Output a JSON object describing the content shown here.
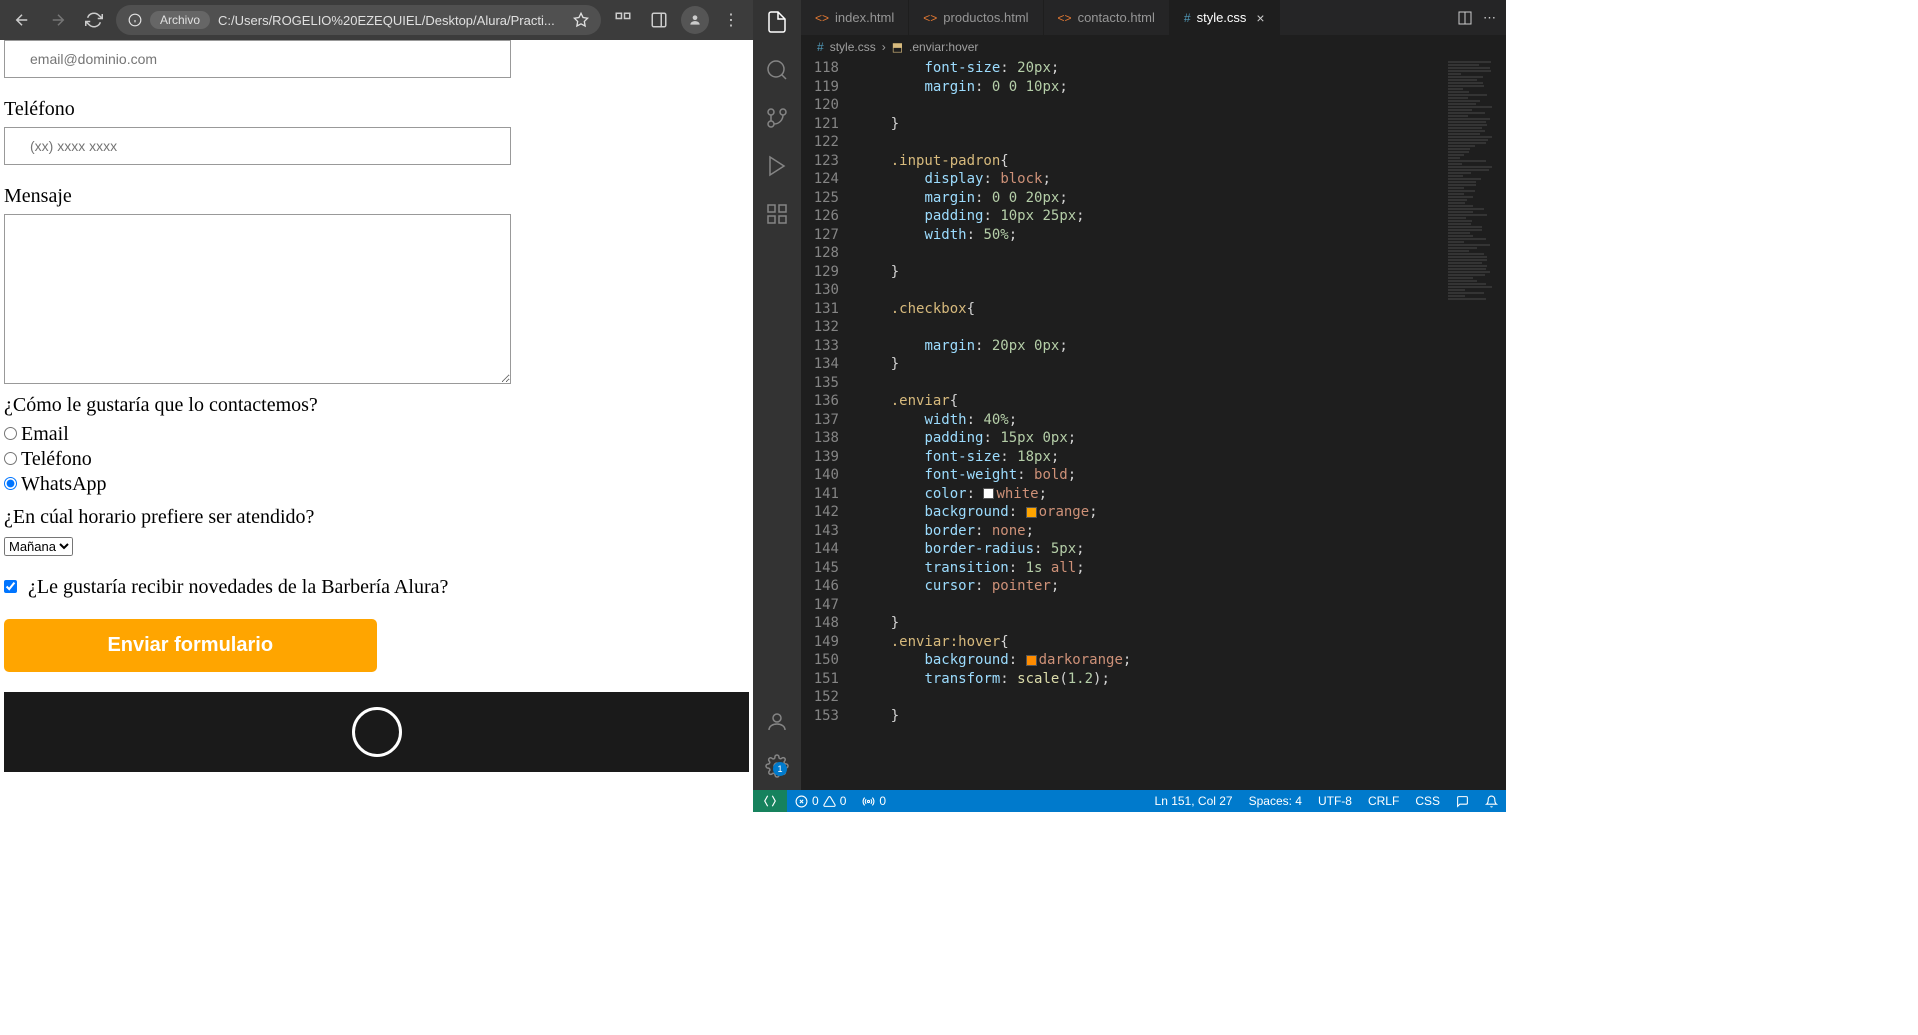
{
  "browser": {
    "url_chip": "Archivo",
    "url": "C:/Users/ROGELIO%20EZEQUIEL/Desktop/Alura/Practi...",
    "form": {
      "email_placeholder": "email@dominio.com",
      "telefono_label": "Teléfono",
      "telefono_placeholder": "(xx) xxxx xxxx",
      "mensaje_label": "Mensaje",
      "contact_question": "¿Cómo le gustaría que lo contactemos?",
      "radio_email": "Email",
      "radio_telefono": "Teléfono",
      "radio_whatsapp": "WhatsApp",
      "horario_question": "¿En cúal horario prefiere ser atendido?",
      "horario_option": "Mañana",
      "newsletter_label": "¿Le gustaría recibir novedades de la Barbería Alura?",
      "submit_label": "Enviar formulario"
    }
  },
  "vscode": {
    "tabs": [
      {
        "label": "index.html",
        "icon": "html"
      },
      {
        "label": "productos.html",
        "icon": "html"
      },
      {
        "label": "contacto.html",
        "icon": "html"
      },
      {
        "label": "style.css",
        "icon": "css",
        "active": true
      }
    ],
    "breadcrumbs": {
      "file": "style.css",
      "symbol": ".enviar:hover"
    },
    "lines": [
      {
        "n": 118,
        "t": "        <span class='tok-prop'>font-size</span><span class='tok-punct'>: </span><span class='tok-num'>20px</span><span class='tok-punct'>;</span>"
      },
      {
        "n": 119,
        "t": "        <span class='tok-prop'>margin</span><span class='tok-punct'>: </span><span class='tok-num'>0 0 10px</span><span class='tok-punct'>;</span>"
      },
      {
        "n": 120,
        "t": ""
      },
      {
        "n": 121,
        "t": "    <span class='tok-punct'>}</span>"
      },
      {
        "n": 122,
        "t": ""
      },
      {
        "n": 123,
        "t": "    <span class='tok-selector'>.input-padron</span><span class='tok-punct'>{</span>"
      },
      {
        "n": 124,
        "t": "        <span class='tok-prop'>display</span><span class='tok-punct'>: </span><span class='tok-value'>block</span><span class='tok-punct'>;</span>"
      },
      {
        "n": 125,
        "t": "        <span class='tok-prop'>margin</span><span class='tok-punct'>: </span><span class='tok-num'>0 0 20px</span><span class='tok-punct'>;</span>"
      },
      {
        "n": 126,
        "t": "        <span class='tok-prop'>padding</span><span class='tok-punct'>: </span><span class='tok-num'>10px 25px</span><span class='tok-punct'>;</span>"
      },
      {
        "n": 127,
        "t": "        <span class='tok-prop'>width</span><span class='tok-punct'>: </span><span class='tok-num'>50%</span><span class='tok-punct'>;</span>"
      },
      {
        "n": 128,
        "t": ""
      },
      {
        "n": 129,
        "t": "    <span class='tok-punct'>}</span>"
      },
      {
        "n": 130,
        "t": ""
      },
      {
        "n": 131,
        "t": "    <span class='tok-selector'>.checkbox</span><span class='tok-punct'>{</span>"
      },
      {
        "n": 132,
        "t": ""
      },
      {
        "n": 133,
        "t": "        <span class='tok-prop'>margin</span><span class='tok-punct'>: </span><span class='tok-num'>20px 0px</span><span class='tok-punct'>;</span>"
      },
      {
        "n": 134,
        "t": "    <span class='tok-punct'>}</span>"
      },
      {
        "n": 135,
        "t": ""
      },
      {
        "n": 136,
        "t": "    <span class='tok-selector'>.enviar</span><span class='tok-punct'>{</span>"
      },
      {
        "n": 137,
        "t": "        <span class='tok-prop'>width</span><span class='tok-punct'>: </span><span class='tok-num'>40%</span><span class='tok-punct'>;</span>"
      },
      {
        "n": 138,
        "t": "        <span class='tok-prop'>padding</span><span class='tok-punct'>: </span><span class='tok-num'>15px 0px</span><span class='tok-punct'>;</span>"
      },
      {
        "n": 139,
        "t": "        <span class='tok-prop'>font-size</span><span class='tok-punct'>: </span><span class='tok-num'>18px</span><span class='tok-punct'>;</span>"
      },
      {
        "n": 140,
        "t": "        <span class='tok-prop'>font-weight</span><span class='tok-punct'>: </span><span class='tok-value'>bold</span><span class='tok-punct'>;</span>"
      },
      {
        "n": 141,
        "t": "        <span class='tok-prop'>color</span><span class='tok-punct'>: </span><span class='color-swatch' style='background:white'></span><span class='tok-value'>white</span><span class='tok-punct'>;</span>"
      },
      {
        "n": 142,
        "t": "        <span class='tok-prop'>background</span><span class='tok-punct'>: </span><span class='color-swatch' style='background:orange'></span><span class='tok-value'>orange</span><span class='tok-punct'>;</span>"
      },
      {
        "n": 143,
        "t": "        <span class='tok-prop'>border</span><span class='tok-punct'>: </span><span class='tok-value'>none</span><span class='tok-punct'>;</span>"
      },
      {
        "n": 144,
        "t": "        <span class='tok-prop'>border-radius</span><span class='tok-punct'>: </span><span class='tok-num'>5px</span><span class='tok-punct'>;</span>"
      },
      {
        "n": 145,
        "t": "        <span class='tok-prop'>transition</span><span class='tok-punct'>: </span><span class='tok-num'>1s</span> <span class='tok-value'>all</span><span class='tok-punct'>;</span>"
      },
      {
        "n": 146,
        "t": "        <span class='tok-prop'>cursor</span><span class='tok-punct'>: </span><span class='tok-value'>pointer</span><span class='tok-punct'>;</span>"
      },
      {
        "n": 147,
        "t": ""
      },
      {
        "n": 148,
        "t": "    <span class='tok-punct'>}</span>"
      },
      {
        "n": 149,
        "t": "    <span class='tok-selector'>.enviar:hover</span><span class='tok-punct'>{</span>"
      },
      {
        "n": 150,
        "t": "        <span class='tok-prop'>background</span><span class='tok-punct'>: </span><span class='color-swatch' style='background:darkorange'></span><span class='tok-value'>darkorange</span><span class='tok-punct'>;</span>"
      },
      {
        "n": 151,
        "t": "        <span class='tok-prop'>transform</span><span class='tok-punct'>: </span><span class='tok-func'>scale</span><span class='tok-punct'>(</span><span class='tok-num'>1.2</span><span class='tok-punct'>);</span>"
      },
      {
        "n": 152,
        "t": ""
      },
      {
        "n": 153,
        "t": "    <span class='tok-punct'>}</span>"
      }
    ],
    "status": {
      "errors": "0",
      "warnings": "0",
      "port": "0",
      "cursor": "Ln 151, Col 27",
      "spaces": "Spaces: 4",
      "encoding": "UTF-8",
      "eol": "CRLF",
      "lang": "CSS"
    }
  }
}
